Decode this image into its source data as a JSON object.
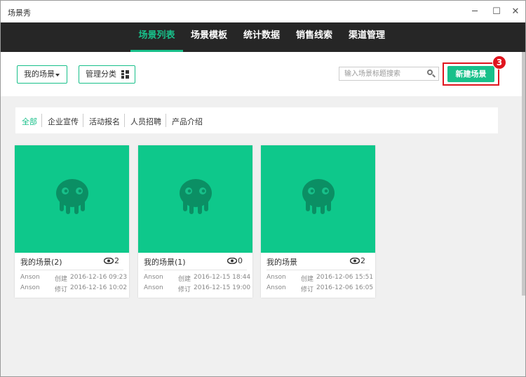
{
  "window": {
    "title": "场景秀",
    "minimize": "─",
    "maximize": "☐",
    "close": "✕"
  },
  "nav": {
    "items": [
      {
        "label": "场景列表",
        "active": true
      },
      {
        "label": "场景模板"
      },
      {
        "label": "统计数据"
      },
      {
        "label": "销售线索"
      },
      {
        "label": "渠道管理"
      }
    ]
  },
  "toolbar": {
    "my_scenes": "我的场景",
    "manage_categories": "管理分类",
    "search_placeholder": "输入场景标题搜索",
    "new_scene": "新建场景",
    "step_badge": "3"
  },
  "categories": [
    {
      "label": "全部",
      "active": true
    },
    {
      "label": "企业宣传"
    },
    {
      "label": "活动报名"
    },
    {
      "label": "人员招聘"
    },
    {
      "label": "产品介绍"
    }
  ],
  "scenes": [
    {
      "title": "我的场景(2)",
      "views": "2",
      "author": "Anson",
      "created_label": "创建",
      "created": "2016-12-16 09:23",
      "modified_label": "修订",
      "modified": "2016-12-16 10:02"
    },
    {
      "title": "我的场景(1)",
      "views": "0",
      "author": "Anson",
      "created_label": "创建",
      "created": "2016-12-15 18:44",
      "modified_label": "修订",
      "modified": "2016-12-15 19:00"
    },
    {
      "title": "我的场景",
      "views": "2",
      "author": "Anson",
      "created_label": "创建",
      "created": "2016-12-06 15:51",
      "modified_label": "修订",
      "modified": "2016-12-06 16:05"
    }
  ],
  "colors": {
    "accent": "#18c08a",
    "nav_bg": "#262626",
    "thumb_bg": "#0ec88b",
    "mascot": "#0b8f64",
    "highlight": "#e0141e"
  }
}
